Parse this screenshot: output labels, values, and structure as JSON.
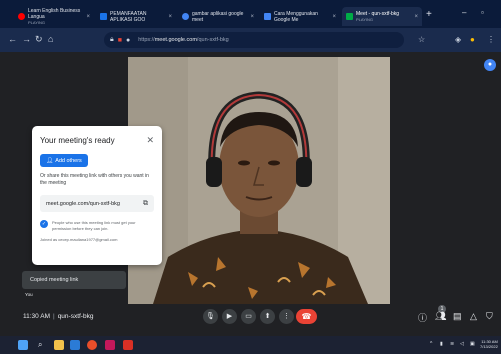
{
  "browser": {
    "tabs": [
      {
        "title": "Learn English Business Langua",
        "subtitle": "PLAYING",
        "favicon_color": "#ff0000"
      },
      {
        "title": "PEMANFAATAN APLIKASI GOO",
        "subtitle": "",
        "favicon_color": "#1a73e8"
      },
      {
        "title": "gambar aplikasi google meet",
        "subtitle": "",
        "favicon_color": "#4285f4"
      },
      {
        "title": "Cara Menggunakan Google Me",
        "subtitle": "",
        "favicon_color": "#4285f4"
      },
      {
        "title": "Meet - qun-sxtf-bkg",
        "subtitle": "PLAYING",
        "favicon_color": "#00ac47"
      }
    ],
    "url_host": "meet.google.com",
    "url_path": "/qun-sxtf-bkg",
    "url_scheme": "https://"
  },
  "dialog": {
    "title": "Your meeting's ready",
    "add_others_label": "Add others",
    "share_text": "Or share this meeting link with others you want in the meeting",
    "meeting_link": "meet.google.com/qun-sxtf-bkg",
    "warning_text": "People who use this meeting link must get your permission before they can join.",
    "joined_as": "Joined as cecep.mauliana1977@gmail.com"
  },
  "snackbar": {
    "text": "Copied meeting link"
  },
  "self_tile": {
    "label": "You"
  },
  "meeting_bar": {
    "time": "11:30 AM",
    "separator": "|",
    "meeting_code": "qun-sxtf-bkg",
    "participant_count": "1"
  },
  "taskbar": {
    "time": "11:30 AM",
    "date": "7/13/2022"
  },
  "colors": {
    "accent": "#1a73e8",
    "hangup": "#ea4335",
    "meet_bg": "#202124"
  }
}
